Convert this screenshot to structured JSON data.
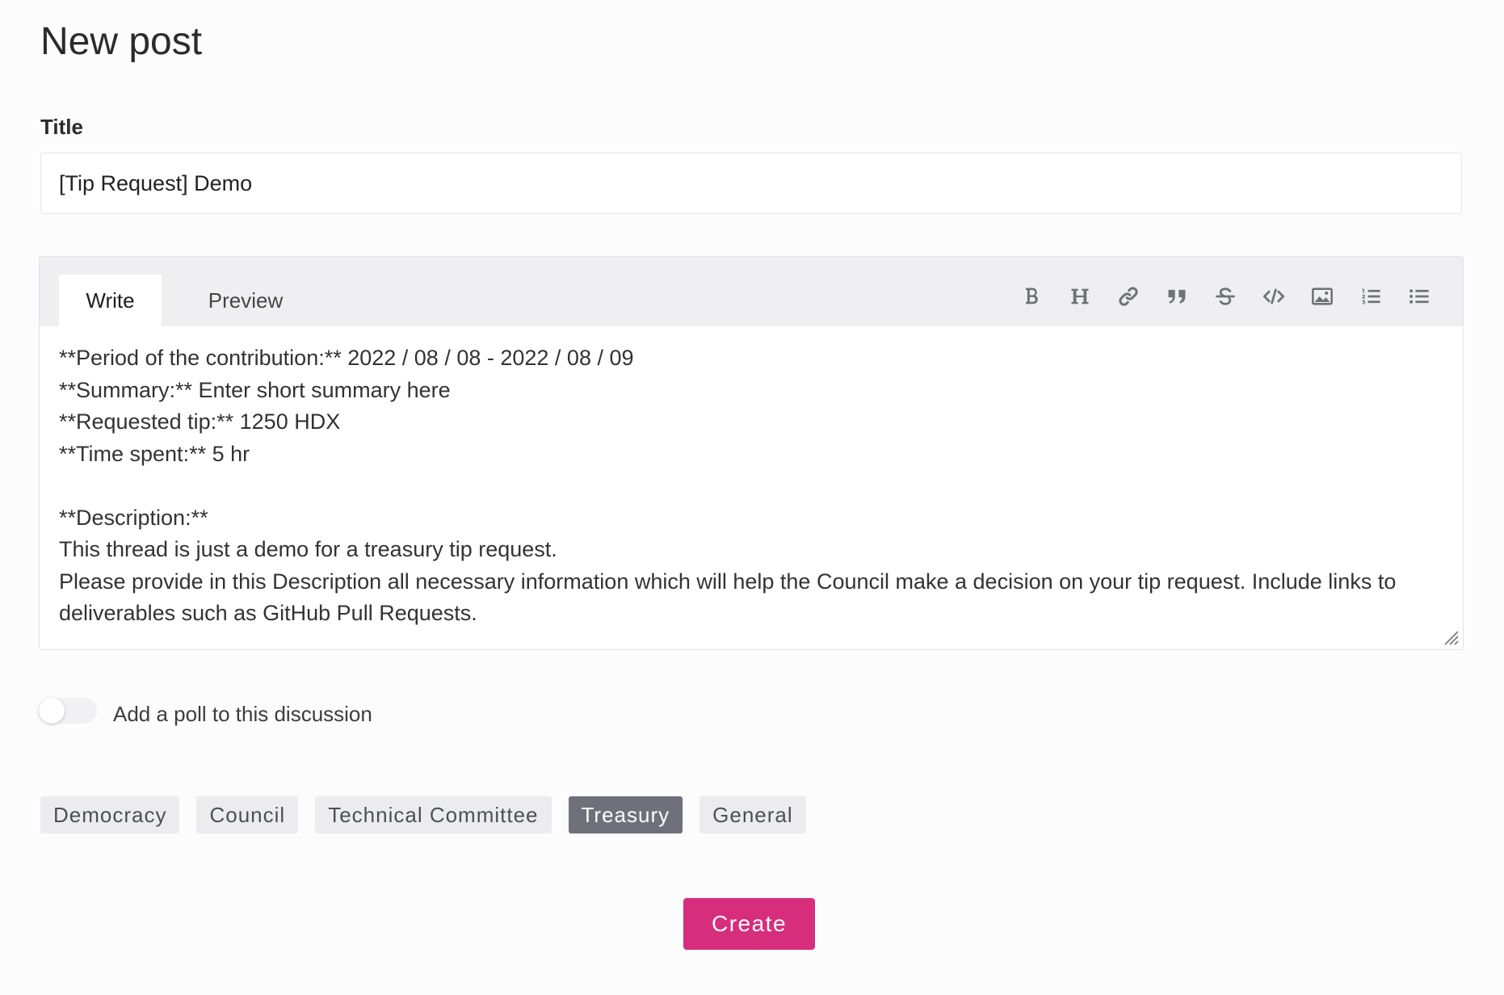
{
  "page": {
    "title": "New post"
  },
  "title_field": {
    "label": "Title",
    "value": "[Tip Request] Demo"
  },
  "editor": {
    "tabs": [
      {
        "label": "Write",
        "active": true
      },
      {
        "label": "Preview",
        "active": false
      }
    ],
    "toolbar": [
      {
        "icon": "bold-icon"
      },
      {
        "icon": "heading-icon"
      },
      {
        "icon": "link-icon"
      },
      {
        "icon": "quote-icon"
      },
      {
        "icon": "strikethrough-icon"
      },
      {
        "icon": "code-icon"
      },
      {
        "icon": "image-icon"
      },
      {
        "icon": "ordered-list-icon"
      },
      {
        "icon": "unordered-list-icon"
      }
    ],
    "content": "**Period of the contribution:** 2022 / 08 / 08 - 2022 / 08 / 09\n**Summary:** Enter short summary here\n**Requested tip:** 1250 HDX\n**Time spent:** 5 hr\n\n**Description:**\nThis thread is just a demo for a treasury tip request.\nPlease provide in this Description all necessary information which will help the Council make a decision on your tip request. Include links to deliverables such as GitHub Pull Requests."
  },
  "poll_toggle": {
    "label": "Add a poll to this discussion",
    "enabled": false
  },
  "tags": [
    {
      "label": "Democracy",
      "selected": false
    },
    {
      "label": "Council",
      "selected": false
    },
    {
      "label": "Technical Committee",
      "selected": false
    },
    {
      "label": "Treasury",
      "selected": true
    },
    {
      "label": "General",
      "selected": false
    }
  ],
  "submit": {
    "label": "Create"
  },
  "colors": {
    "primary": "#d62d7c",
    "tag_selected_bg": "#6e7179",
    "tag_bg": "#ececef"
  }
}
